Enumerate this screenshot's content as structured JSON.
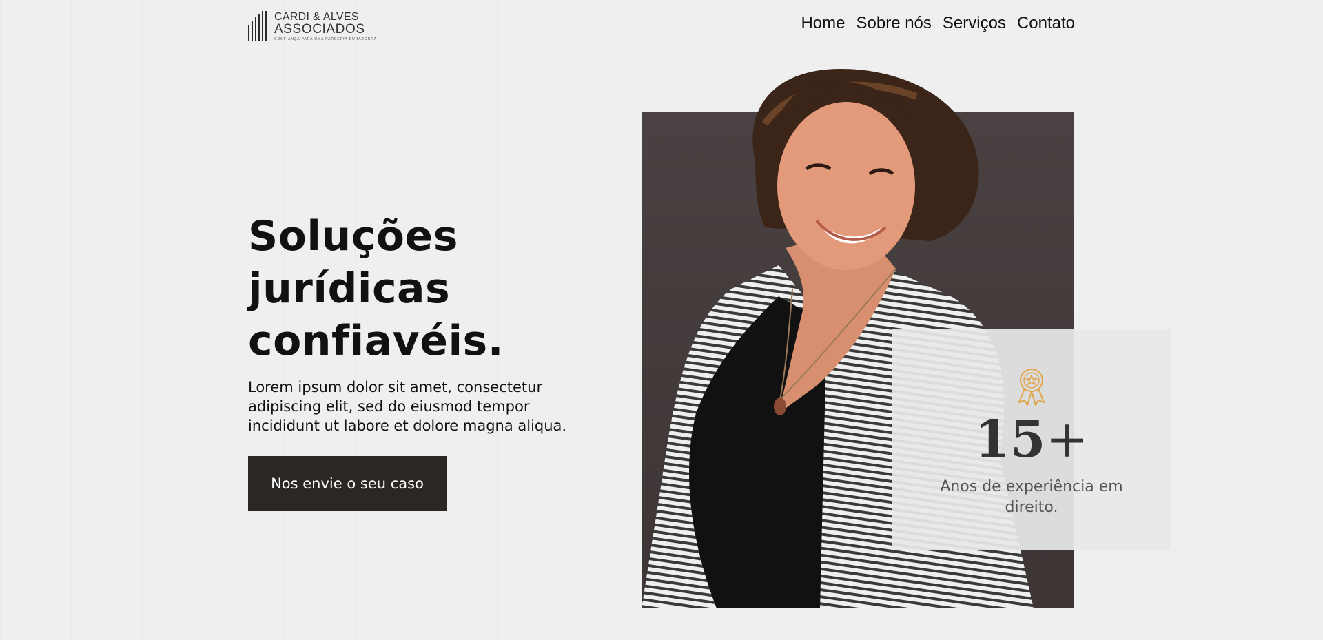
{
  "header": {
    "logo": {
      "line1": "CARDI & ALVES",
      "line2": "ASSOCIADOS",
      "tagline": "CONFIANÇA PARA UMA PARCERIA DURADOURA"
    },
    "nav": [
      {
        "label": "Home"
      },
      {
        "label": "Sobre nós"
      },
      {
        "label": "Serviços"
      },
      {
        "label": "Contato"
      }
    ]
  },
  "hero": {
    "title_lines": [
      "Soluções",
      "jurídicas",
      "confiavéis."
    ],
    "description": "Lorem ipsum dolor sit amet, consectetur adipiscing elit, sed do eiusmod tempor incididunt ut labore et dolore magna aliqua.",
    "cta_label": "Nos envie o seu caso"
  },
  "stat": {
    "number": "15",
    "suffix": "+",
    "label": "Anos de experiência em direito.",
    "icon": "award-ribbon-icon"
  },
  "colors": {
    "background": "#efefef",
    "button": "#2b2725",
    "photo_backdrop": "#433b3a",
    "accent_gold": "#e0a64a",
    "card": "#e8e8e8"
  }
}
